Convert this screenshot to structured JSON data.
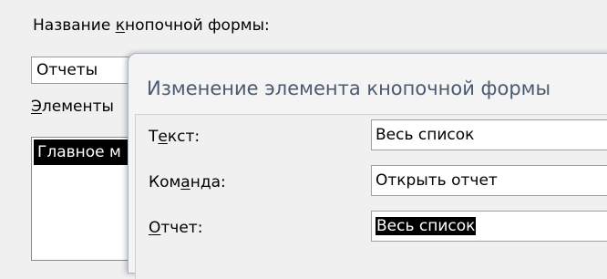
{
  "switchboard": {
    "form_name_label_pre": "Название ",
    "form_name_label_key": "к",
    "form_name_label_post": "нопочной формы:",
    "form_name_value": "Отчеты",
    "items_label_key": "Э",
    "items_label_post": "лементы",
    "selected_item": "Главное м"
  },
  "dialog": {
    "title": "Изменение элемента кнопочной формы",
    "text_label_pre": "Т",
    "text_label_key": "е",
    "text_label_post": "кст:",
    "text_value": "Весь список",
    "command_label_pre": "Ком",
    "command_label_key": "а",
    "command_label_post": "нда:",
    "command_value": "Открыть отчет",
    "report_label_key": "О",
    "report_label_post": "тчет:",
    "report_value": "Весь список"
  }
}
